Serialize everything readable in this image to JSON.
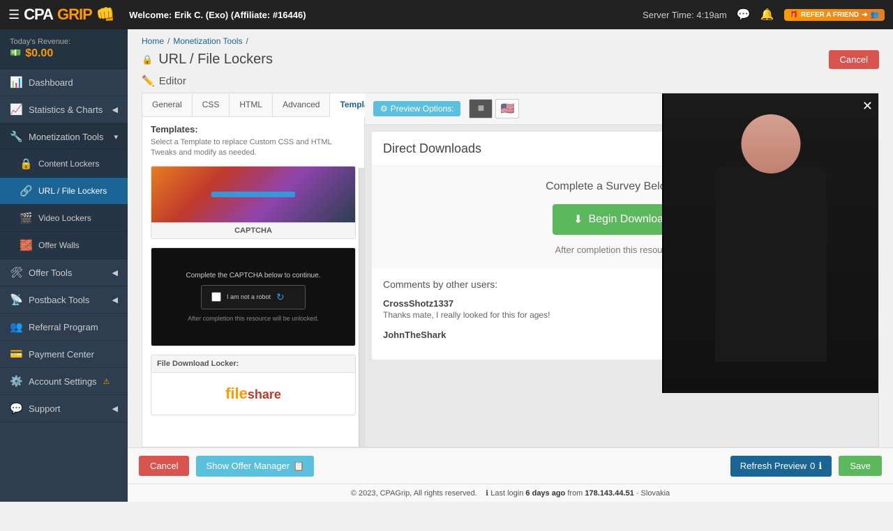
{
  "navbar": {
    "brand_cpa": "CPA",
    "brand_grip": "GRIP",
    "welcome_text": "Welcome:",
    "user_name": "Erik C. (Exo)",
    "affiliate_label": "(Affiliate: #16446)",
    "server_time": "Server Time: 4:19am"
  },
  "sidebar": {
    "revenue_label": "Today's Revenue:",
    "revenue_amount": "$0.00",
    "items": [
      {
        "id": "dashboard",
        "label": "Dashboard",
        "icon": "📊",
        "active": false
      },
      {
        "id": "statistics",
        "label": "Statistics & Charts",
        "icon": "📈",
        "active": false,
        "has_arrow": true
      },
      {
        "id": "monetization",
        "label": "Monetization Tools",
        "icon": "💼",
        "active": true,
        "has_arrow": true
      },
      {
        "id": "content-lockers",
        "label": "Content Lockers",
        "icon": "🔒",
        "sub": true,
        "active": false
      },
      {
        "id": "url-lockers",
        "label": "URL / File Lockers",
        "icon": "🔗",
        "sub": true,
        "active": true
      },
      {
        "id": "video-lockers",
        "label": "Video Lockers",
        "icon": "🎬",
        "sub": true,
        "active": false
      },
      {
        "id": "offer-walls",
        "label": "Offer Walls",
        "icon": "🧱",
        "sub": true,
        "active": false
      },
      {
        "id": "offer-tools",
        "label": "Offer Tools",
        "icon": "🛠",
        "active": false,
        "has_arrow": true
      },
      {
        "id": "postback-tools",
        "label": "Postback Tools",
        "icon": "📡",
        "active": false,
        "has_arrow": true
      },
      {
        "id": "referral",
        "label": "Referral Program",
        "icon": "👥",
        "active": false
      },
      {
        "id": "payment",
        "label": "Payment Center",
        "icon": "💳",
        "active": false
      },
      {
        "id": "account",
        "label": "Account Settings",
        "icon": "⚙️",
        "active": false,
        "has_warning": true
      },
      {
        "id": "support",
        "label": "Support",
        "icon": "💬",
        "active": false,
        "has_arrow": true
      }
    ]
  },
  "breadcrumb": {
    "home": "Home",
    "monetization": "Monetization Tools",
    "current": "URL / File Lockers"
  },
  "page": {
    "title": "URL / File Lockers",
    "editor_label": "Editor",
    "cancel_label": "Cancel"
  },
  "tabs": [
    {
      "id": "general",
      "label": "General"
    },
    {
      "id": "css",
      "label": "CSS"
    },
    {
      "id": "html",
      "label": "HTML"
    },
    {
      "id": "advanced",
      "label": "Advanced"
    },
    {
      "id": "templates",
      "label": "Templates",
      "active": true
    }
  ],
  "templates_panel": {
    "heading": "Templates:",
    "hint": "Select a Template to replace Custom CSS and HTML Tweaks and modify as needed.",
    "template1_label": "CAPTCHA",
    "template2_label": "File Download Locker:"
  },
  "preview": {
    "options_label": "Preview Options:",
    "direct_downloads_title": "Direct Downloads",
    "survey_text": "Complete a Survey Below to C",
    "begin_download_label": "Begin Download",
    "after_completion": "After completion this resource wil",
    "comments_heading": "Comments by other users:",
    "comments": [
      {
        "user": "CrossShotz1337",
        "text": "Thanks mate, I really looked for this for ages!"
      },
      {
        "user": "JohnTheShark",
        "text": ""
      }
    ]
  },
  "bottom_bar": {
    "cancel_label": "Cancel",
    "show_offer_label": "Show Offer Manager",
    "refresh_label": "Refresh Preview",
    "refresh_count": "0",
    "save_label": "Save"
  },
  "footer": {
    "copyright": "© 2023, CPAGrip, All rights reserved.",
    "last_login_prefix": "Last login",
    "last_login_time": "6 days ago",
    "last_login_from": "from",
    "last_login_ip": "178.143.44.51",
    "last_login_location": "Slovakia"
  }
}
